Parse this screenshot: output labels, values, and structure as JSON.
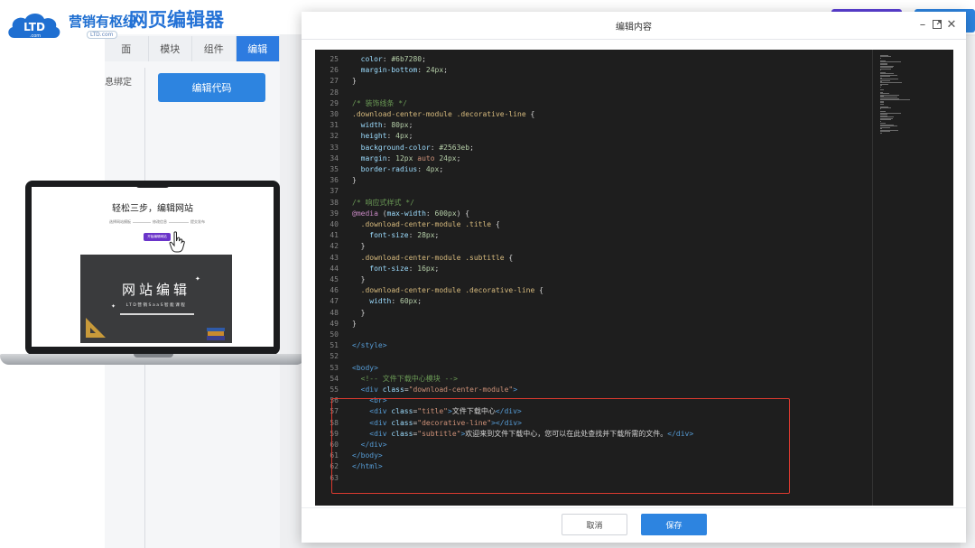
{
  "brand": {
    "logo_mark": "LTD",
    "logo_sub_mark": ".com",
    "logo_text": "营销有枢纽",
    "logo_url_tag": "LTD.com",
    "app_title": "网页编辑器"
  },
  "background": {
    "tabs": [
      {
        "label": "面",
        "active": false
      },
      {
        "label": "模块",
        "active": false
      },
      {
        "label": "组件",
        "active": false
      },
      {
        "label": "编辑",
        "active": true
      }
    ],
    "side_label": "息绑定",
    "edit_code_button": "编辑代码"
  },
  "preview": {
    "title": "轻松三步，编辑网站",
    "steps": [
      "选择网站模板",
      "修改信息",
      "提交发布"
    ],
    "button": "开始编辑网站",
    "video_title": "网站编辑",
    "video_subtitle": "LTD营销SaaS智能课程"
  },
  "modal": {
    "title": "编辑内容",
    "window_buttons": [
      "minimize-icon",
      "maximize-icon",
      "close-icon"
    ],
    "cancel_label": "取消",
    "save_label": "保存"
  },
  "code_lines": [
    {
      "n": "25",
      "tokens": [
        [
          "prop",
          "  color"
        ],
        [
          "punc",
          ": "
        ],
        [
          "num",
          "#6b7280"
        ],
        [
          "punc",
          ";"
        ]
      ]
    },
    {
      "n": "26",
      "tokens": [
        [
          "prop",
          "  margin-bottom"
        ],
        [
          "punc",
          ": "
        ],
        [
          "num",
          "24px"
        ],
        [
          "punc",
          ";"
        ]
      ]
    },
    {
      "n": "27",
      "tokens": [
        [
          "punc",
          "}"
        ]
      ]
    },
    {
      "n": "28",
      "tokens": []
    },
    {
      "n": "29",
      "tokens": [
        [
          "com",
          "/* 装饰线条 */"
        ]
      ]
    },
    {
      "n": "30",
      "tokens": [
        [
          "sel",
          ".download-center-module .decorative-line"
        ],
        [
          "punc",
          " {"
        ]
      ]
    },
    {
      "n": "31",
      "tokens": [
        [
          "prop",
          "  width"
        ],
        [
          "punc",
          ": "
        ],
        [
          "num",
          "80px"
        ],
        [
          "punc",
          ";"
        ]
      ]
    },
    {
      "n": "32",
      "tokens": [
        [
          "prop",
          "  height"
        ],
        [
          "punc",
          ": "
        ],
        [
          "num",
          "4px"
        ],
        [
          "punc",
          ";"
        ]
      ]
    },
    {
      "n": "33",
      "tokens": [
        [
          "prop",
          "  background-color"
        ],
        [
          "punc",
          ": "
        ],
        [
          "num",
          "#2563eb"
        ],
        [
          "punc",
          ";"
        ]
      ]
    },
    {
      "n": "34",
      "tokens": [
        [
          "prop",
          "  margin"
        ],
        [
          "punc",
          ": "
        ],
        [
          "num",
          "12px"
        ],
        [
          "str",
          " auto "
        ],
        [
          "num",
          "24px"
        ],
        [
          "punc",
          ";"
        ]
      ]
    },
    {
      "n": "35",
      "tokens": [
        [
          "prop",
          "  border-radius"
        ],
        [
          "punc",
          ": "
        ],
        [
          "num",
          "4px"
        ],
        [
          "punc",
          ";"
        ]
      ]
    },
    {
      "n": "36",
      "tokens": [
        [
          "punc",
          "}"
        ]
      ]
    },
    {
      "n": "37",
      "tokens": []
    },
    {
      "n": "38",
      "tokens": [
        [
          "com",
          "/* 响应式样式 */"
        ]
      ]
    },
    {
      "n": "39",
      "tokens": [
        [
          "kw",
          "@media"
        ],
        [
          "punc",
          " ("
        ],
        [
          "prop",
          "max-width"
        ],
        [
          "punc",
          ": "
        ],
        [
          "num",
          "600px"
        ],
        [
          "punc",
          ") {"
        ]
      ]
    },
    {
      "n": "40",
      "tokens": [
        [
          "sel",
          "  .download-center-module .title"
        ],
        [
          "punc",
          " {"
        ]
      ]
    },
    {
      "n": "41",
      "tokens": [
        [
          "prop",
          "    font-size"
        ],
        [
          "punc",
          ": "
        ],
        [
          "num",
          "28px"
        ],
        [
          "punc",
          ";"
        ]
      ]
    },
    {
      "n": "42",
      "tokens": [
        [
          "punc",
          "  }"
        ]
      ]
    },
    {
      "n": "43",
      "tokens": [
        [
          "sel",
          "  .download-center-module .subtitle"
        ],
        [
          "punc",
          " {"
        ]
      ]
    },
    {
      "n": "44",
      "tokens": [
        [
          "prop",
          "    font-size"
        ],
        [
          "punc",
          ": "
        ],
        [
          "num",
          "16px"
        ],
        [
          "punc",
          ";"
        ]
      ]
    },
    {
      "n": "45",
      "tokens": [
        [
          "punc",
          "  }"
        ]
      ]
    },
    {
      "n": "46",
      "tokens": [
        [
          "sel",
          "  .download-center-module .decorative-line"
        ],
        [
          "punc",
          " {"
        ]
      ]
    },
    {
      "n": "47",
      "tokens": [
        [
          "prop",
          "    width"
        ],
        [
          "punc",
          ": "
        ],
        [
          "num",
          "60px"
        ],
        [
          "punc",
          ";"
        ]
      ]
    },
    {
      "n": "48",
      "tokens": [
        [
          "punc",
          "  }"
        ]
      ]
    },
    {
      "n": "49",
      "tokens": [
        [
          "punc",
          "}"
        ]
      ]
    },
    {
      "n": "50",
      "tokens": []
    },
    {
      "n": "51",
      "tokens": [
        [
          "tag",
          "</style>"
        ]
      ]
    },
    {
      "n": "52",
      "tokens": []
    },
    {
      "n": "53",
      "tokens": [
        [
          "tag",
          "<body>"
        ]
      ]
    },
    {
      "n": "54",
      "tokens": [
        [
          "com",
          "  <!-- 文件下载中心模块 -->"
        ]
      ]
    },
    {
      "n": "55",
      "tokens": [
        [
          "tag",
          "  <div "
        ],
        [
          "attr",
          "class"
        ],
        [
          "punc",
          "="
        ],
        [
          "str",
          "\"download-center-module\""
        ],
        [
          "tag",
          ">"
        ]
      ]
    },
    {
      "n": "56",
      "tokens": [
        [
          "tag",
          "    <br>"
        ]
      ]
    },
    {
      "n": "57",
      "tokens": [
        [
          "tag",
          "    <div "
        ],
        [
          "attr",
          "class"
        ],
        [
          "punc",
          "="
        ],
        [
          "str",
          "\"title\""
        ],
        [
          "tag",
          ">"
        ],
        [
          "plain",
          "文件下载中心"
        ],
        [
          "tag",
          "</div>"
        ]
      ]
    },
    {
      "n": "58",
      "tokens": [
        [
          "tag",
          "    <div "
        ],
        [
          "attr",
          "class"
        ],
        [
          "punc",
          "="
        ],
        [
          "str",
          "\"decorative-line\""
        ],
        [
          "tag",
          "></div>"
        ]
      ]
    },
    {
      "n": "59",
      "tokens": [
        [
          "tag",
          "    <div "
        ],
        [
          "attr",
          "class"
        ],
        [
          "punc",
          "="
        ],
        [
          "str",
          "\"subtitle\""
        ],
        [
          "tag",
          ">"
        ],
        [
          "plain",
          "欢迎来到文件下载中心，您可以在此处查找并下载所需的文件。"
        ],
        [
          "tag",
          "</div>"
        ]
      ]
    },
    {
      "n": "60",
      "tokens": [
        [
          "tag",
          "  </div>"
        ]
      ]
    },
    {
      "n": "61",
      "tokens": [
        [
          "tag",
          "</body>"
        ]
      ]
    },
    {
      "n": "62",
      "tokens": [
        [
          "tag",
          "</html>"
        ]
      ]
    },
    {
      "n": "63",
      "tokens": []
    }
  ],
  "colors": {
    "accent_blue": "#2d84e0",
    "brand_blue": "#1f6fd1",
    "purple": "#6a34c9",
    "editor_bg": "#1e1e1e",
    "highlight_red": "#d93a2f"
  }
}
